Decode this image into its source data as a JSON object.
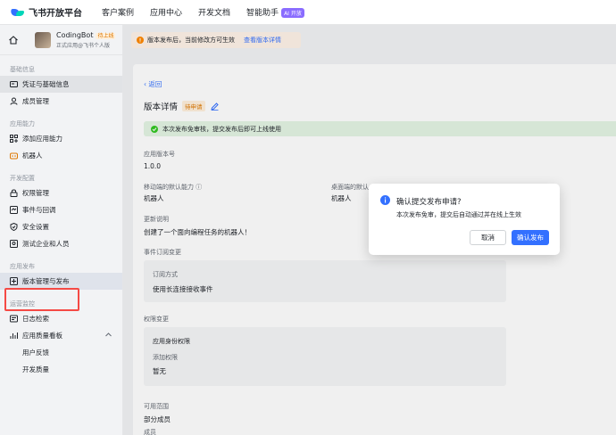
{
  "topnav": {
    "logo_text": "飞书开放平台",
    "links": [
      "客户案例",
      "应用中心",
      "开发文档",
      "智能助手"
    ],
    "ai_badge": "AI 开放"
  },
  "app": {
    "name": "CodingBot",
    "status": "待上线",
    "subtitle": "正式应用@飞书个人版"
  },
  "notice": {
    "text": "版本发布后，当前修改方可生效",
    "link": "查看版本详情"
  },
  "sidebar": {
    "groups": [
      {
        "title": "基础信息",
        "items": [
          "凭证与基础信息",
          "成员管理"
        ]
      },
      {
        "title": "应用能力",
        "items": [
          "添加应用能力",
          "机器人"
        ]
      },
      {
        "title": "开发配置",
        "items": [
          "权限管理",
          "事件与回调",
          "安全设置",
          "测试企业和人员"
        ]
      },
      {
        "title": "应用发布",
        "items": [
          "版本管理与发布"
        ]
      },
      {
        "title": "运营监控",
        "items": [
          "日志检索",
          "应用质量看板"
        ],
        "subitems": [
          "用户反馈",
          "开发质量"
        ]
      }
    ]
  },
  "detail": {
    "back": "返回",
    "title": "版本详情",
    "status_tag": "待申请",
    "success_msg": "本次发布免审核，提交发布后即可上线使用",
    "version_label": "应用版本号",
    "version_value": "1.0.0",
    "mobile_label": "移动端的默认能力",
    "mobile_value": "机器人",
    "desktop_label": "桌面端的默认",
    "desktop_value": "机器人",
    "desc_label": "更新说明",
    "desc_value": "创建了一个面向编程任务的机器人！",
    "events_label": "事件订阅变更",
    "sub_method_label": "订阅方式",
    "sub_method_value": "使用长连接接收事件",
    "perm_label": "权限变更",
    "perm_type_label": "应用身份权限",
    "perm_add_label": "添加权限",
    "perm_add_value": "暂无",
    "scope_label": "可用范围",
    "scope_value": "部分成员",
    "member_label": "成员"
  },
  "dialog": {
    "title": "确认提交发布申请?",
    "body": "本次发布免审，提交后自动通过并在线上生效",
    "cancel": "取消",
    "confirm": "确认发布"
  },
  "colors": {
    "primary": "#3370ff",
    "warning": "#de7802",
    "success": "#34c724",
    "highlight_box": "#f54a45"
  }
}
